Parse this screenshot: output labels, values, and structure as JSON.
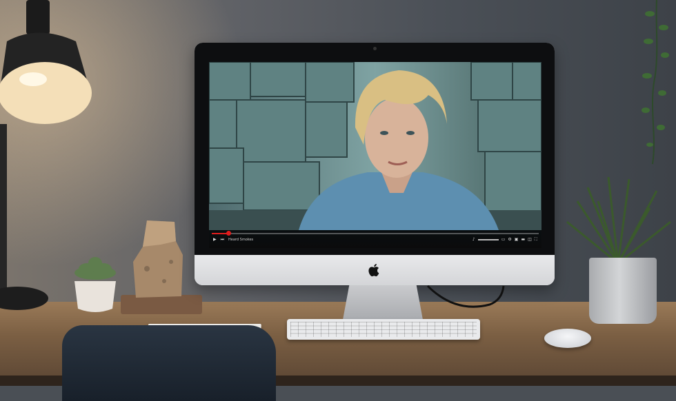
{
  "scene": {
    "screen": {
      "player": {
        "progress_fraction": 0.05,
        "caption": "Heard Smokes",
        "controls": {
          "play_icon": "play-icon",
          "next_icon": "next-icon",
          "volume_icon": "volume-icon",
          "settings_icon": "settings-icon",
          "fullscreen_icon": "fullscreen-icon"
        },
        "progress_color": "#e11d1d"
      }
    },
    "apple_logo": "apple-logo-icon"
  }
}
